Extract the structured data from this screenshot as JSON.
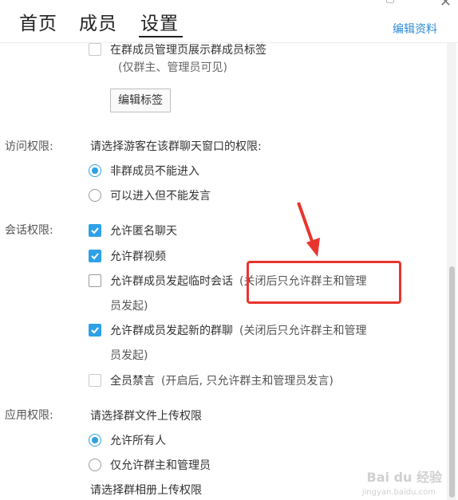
{
  "header": {
    "tabs": [
      "首页",
      "成员",
      "设置"
    ],
    "edit_profile": "编辑资料"
  },
  "member_tag": {
    "checkbox_label": "在群成员管理页展示群成员标签",
    "note": "(仅群主、管理员可见)",
    "edit_tag_button": "编辑标签"
  },
  "visit": {
    "section_label": "访问权限:",
    "prompt": "请选择游客在该群聊天窗口的权限:",
    "options": [
      "非群成员不能进入",
      "可以进入但不能发言"
    ],
    "selected": 0
  },
  "session": {
    "section_label": "会话权限:",
    "items": [
      {
        "label": "允许匿名聊天",
        "note": "",
        "cont": "",
        "checked": true
      },
      {
        "label": "允许群视频",
        "note": "",
        "cont": "",
        "checked": true
      },
      {
        "label": "允许群成员发起临时会话",
        "note": "(关闭后只允许群主和管理",
        "cont": "员发起)",
        "checked": false
      },
      {
        "label": "允许群成员发起新的群聊",
        "note": "(关闭后只允许群主和管理",
        "cont": "员发起)",
        "checked": true
      },
      {
        "label": "全员禁言",
        "note": "(开启后, 只允许群主和管理员发言)",
        "cont": "",
        "checked": false
      }
    ]
  },
  "app": {
    "section_label": "应用权限:",
    "file_prompt": "请选择群文件上传权限",
    "file_options": [
      "允许所有人",
      "仅允许群主和管理员"
    ],
    "file_selected": 0,
    "album_prompt": "请选择群相册上传权限"
  },
  "watermark": {
    "main": "Bai du 经验",
    "sub": "jingyan.baidu.com"
  },
  "colors": {
    "accent": "#2ea1e6",
    "link": "#2d8ad8",
    "annotation": "#e8342f"
  }
}
